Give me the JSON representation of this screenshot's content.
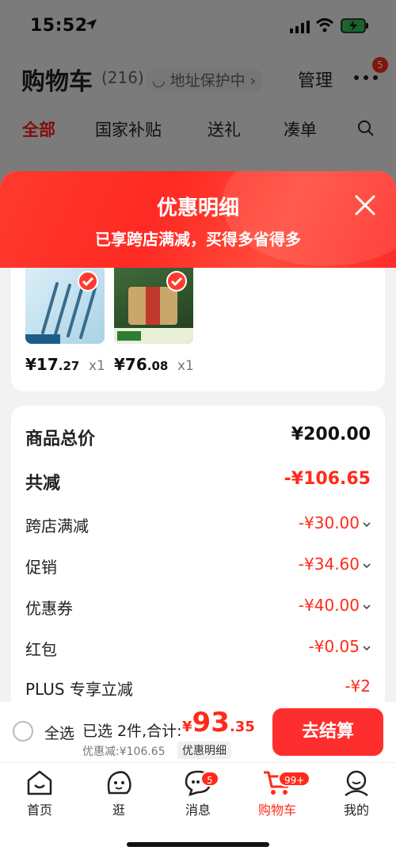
{
  "status_bar": {
    "time": "15:52"
  },
  "cart_header": {
    "title": "购物车",
    "count": "(216)",
    "address_protect": "◡ 地址保护中 ›",
    "manage": "管理",
    "more_badge": "5"
  },
  "filter_tabs": [
    "全部",
    "国家补贴",
    "送礼",
    "凑单"
  ],
  "sheet": {
    "title": "优惠明细",
    "subtitle": "已享跨店满减，买得多省得多"
  },
  "products": [
    {
      "name": "pens",
      "price_int": "¥17",
      "price_dec": ".27",
      "qty": "x1"
    },
    {
      "name": "tea",
      "price_int": "¥76",
      "price_dec": ".08",
      "qty": "x1"
    }
  ],
  "details": {
    "total_label": "商品总价",
    "total_value": "¥200.00",
    "reduce_label": "共减",
    "reduce_value": "-¥106.65",
    "cross_label": "跨店满减",
    "cross_value": "-¥30.00",
    "promo_label": "促销",
    "promo_value": "-¥34.60",
    "coupon_label": "优惠券",
    "coupon_value": "-¥40.00",
    "redpacket_label": "红包",
    "redpacket_value": "-¥0.05",
    "plus_label": "PLUS 专享立减",
    "plus_value": "-¥2"
  },
  "checkout": {
    "select_all": "全选",
    "selected_text": "已选 2件,合计:",
    "currency": "¥",
    "total_int": "93",
    "total_dec": ".35",
    "discount_note": "优惠减:¥106.65",
    "detail_chip": "优惠明细",
    "button": "去结算"
  },
  "tab_bar": {
    "items": [
      "首页",
      "逛",
      "消息",
      "购物车",
      "我的"
    ],
    "message_badge": "5",
    "cart_badge": "99+"
  },
  "colors": {
    "accent": "#ff2a1a",
    "header": "#ff3a2e"
  }
}
